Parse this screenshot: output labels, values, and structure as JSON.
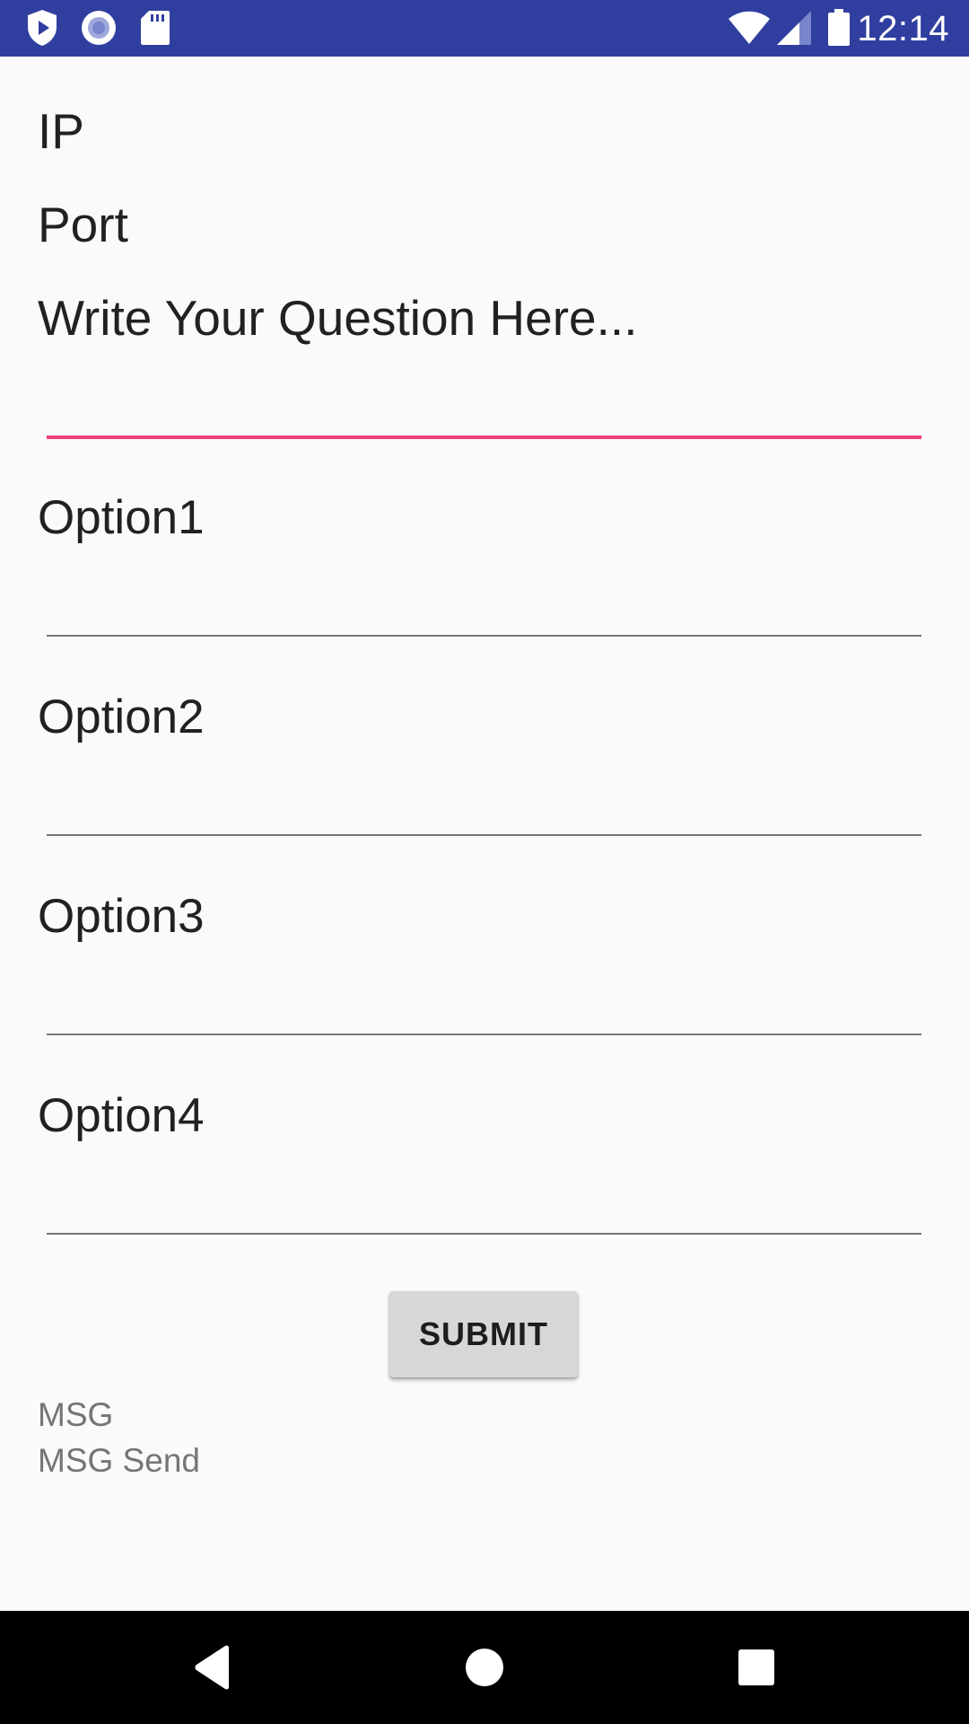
{
  "status_bar": {
    "time": "12:14",
    "left_icons": [
      "shield-play-icon",
      "record-circle-icon",
      "sd-card-icon"
    ],
    "right_icons": [
      "wifi-icon",
      "cell-signal-icon",
      "battery-icon"
    ],
    "background_color": "#303f9f"
  },
  "form": {
    "ip_label": "IP",
    "port_label": "Port",
    "question_placeholder": "Write Your Question Here...",
    "options": [
      {
        "placeholder": "Option1"
      },
      {
        "placeholder": "Option2"
      },
      {
        "placeholder": "Option3"
      },
      {
        "placeholder": "Option4"
      }
    ],
    "focus_color": "#e91e63"
  },
  "actions": {
    "submit_label": "SUBMIT"
  },
  "messages": {
    "msg": "MSG",
    "msg_send": "MSG Send"
  },
  "nav_bar": {
    "buttons": [
      "back-icon",
      "home-icon",
      "recents-icon"
    ]
  }
}
